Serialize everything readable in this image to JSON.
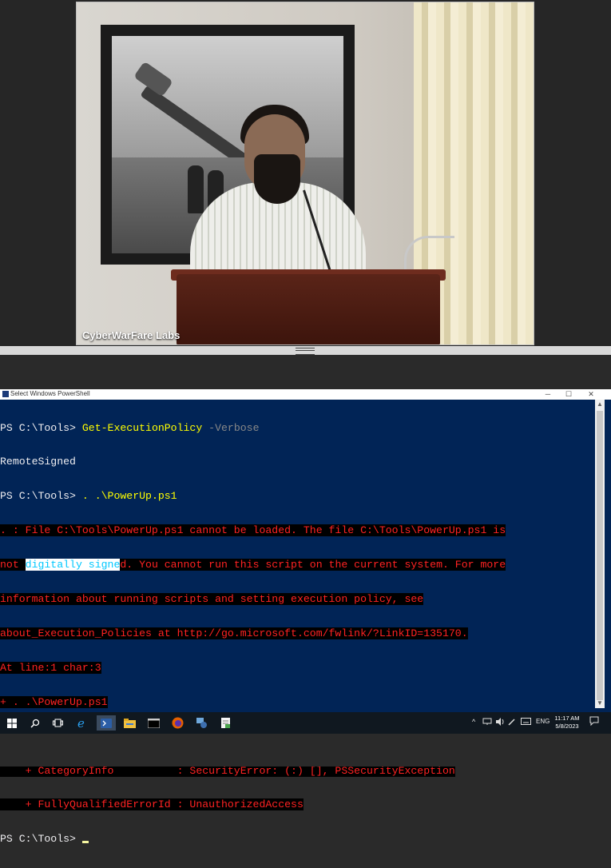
{
  "video": {
    "label": "CyberWarFare Labs"
  },
  "powershell": {
    "title": "Select Windows PowerShell",
    "controls": {
      "minimize": "─",
      "maximize": "☐",
      "close": "✕"
    },
    "lines": {
      "l1_prompt": "PS C:\\Tools> ",
      "l1_cmd": "Get-ExecutionPolicy",
      "l1_param": " -Verbose",
      "l2": "RemoteSigned",
      "l3_prompt": "PS C:\\Tools> ",
      "l3_cmd": ". .\\PowerUp.ps1",
      "e1": ". : File C:\\Tools\\PowerUp.ps1 cannot be loaded. The file C:\\Tools\\PowerUp.ps1 is",
      "e2a": "not ",
      "e2sel": "digitally signe",
      "e2b": "d. You cannot run this script on the current system. For more",
      "e3": "information about running scripts and setting execution policy, see",
      "e4": "about_Execution_Policies at http://go.microsoft.com/fwlink/?LinkID=135170.",
      "e5": "At line:1 char:3",
      "e6": "+ . .\\PowerUp.ps1",
      "e7": "+   ~~~~~~~~~~~~~~",
      "e8": "    + CategoryInfo          : SecurityError: (:) [], PSSecurityException",
      "e9": "    + FullyQualifiedErrorId : UnauthorizedAccess",
      "final_prompt": "PS C:\\Tools> "
    }
  },
  "taskbar": {
    "icons": [
      "windows-start",
      "search",
      "task-view",
      "internet-explorer",
      "powershell",
      "file-explorer",
      "cmd",
      "firefox",
      "network-admin",
      "notepad"
    ],
    "tray": {
      "language": "ENG",
      "time": "11:17 AM",
      "date": "5/8/2023"
    }
  },
  "colors": {
    "console_bg": "#012456",
    "prompt_text": "#eeedf0",
    "command": "#ffff00",
    "parameter": "#888888",
    "error_text": "#ff2222",
    "error_bg": "#000000"
  }
}
